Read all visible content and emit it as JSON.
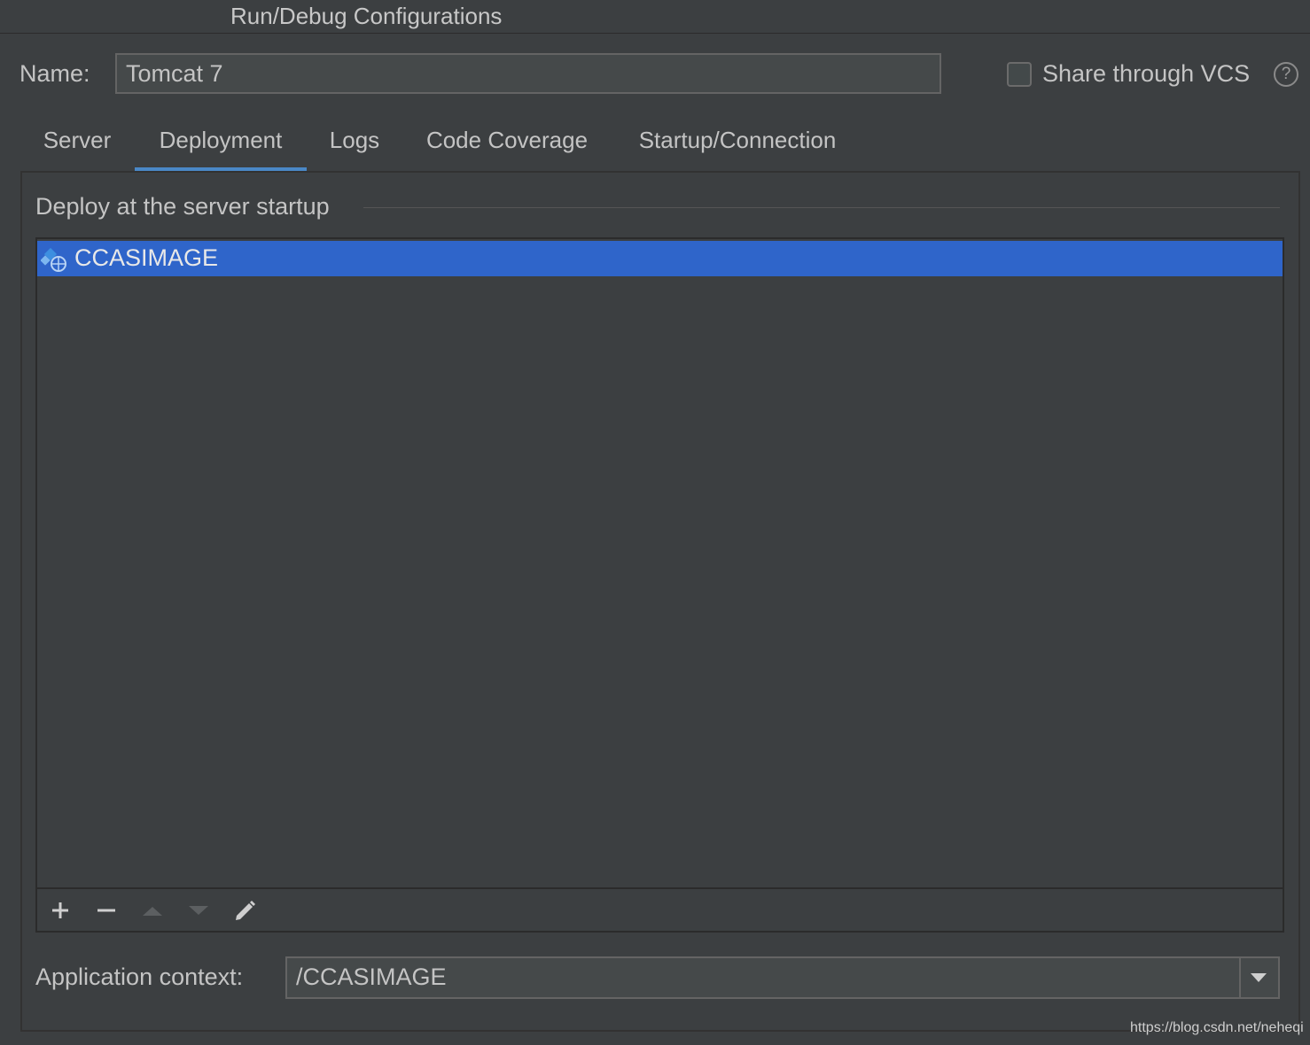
{
  "window": {
    "title": "Run/Debug Configurations"
  },
  "name_field": {
    "label": "Name:",
    "value": "Tomcat 7"
  },
  "share": {
    "label": "Share through VCS",
    "checked": false,
    "help_icon": "question-circle-icon",
    "help_glyph": "?"
  },
  "tabs": [
    {
      "label": "Server"
    },
    {
      "label": "Deployment",
      "active": true
    },
    {
      "label": "Logs"
    },
    {
      "label": "Code Coverage"
    },
    {
      "label": "Startup/Connection"
    }
  ],
  "deploy": {
    "section_label": "Deploy at the server startup",
    "items": [
      {
        "label": "CCASIMAGE",
        "selected": true,
        "icon": "web-artifact-icon"
      }
    ],
    "toolbar": [
      "add-icon",
      "remove-icon",
      "move-up-icon",
      "move-down-icon",
      "edit-icon"
    ]
  },
  "app_context": {
    "label": "Application context:",
    "value": "/CCASIMAGE"
  },
  "watermark": "https://blog.csdn.net/neheqi",
  "colors": {
    "background": "#3c3f41",
    "selection": "#2f65ca",
    "tab_underline": "#4a88c7",
    "input_bg": "#45494a"
  }
}
